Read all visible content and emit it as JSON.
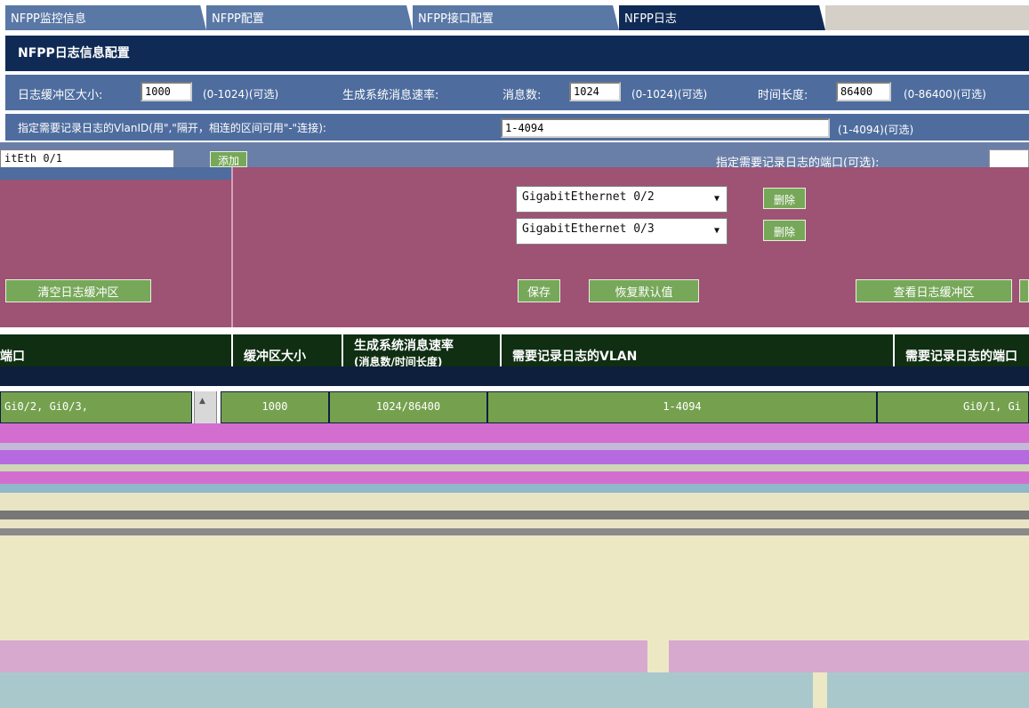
{
  "tabs": [
    {
      "label": "NFPP监控信息"
    },
    {
      "label": "NFPP配置"
    },
    {
      "label": "NFPP接口配置"
    },
    {
      "label": "NFPP日志"
    }
  ],
  "panel_title": "NFPP日志信息配置",
  "buffer": {
    "label": "日志缓冲区大小:",
    "value": "1000",
    "range": "(0-1024)(可选)"
  },
  "rate": {
    "label": "生成系统消息速率:",
    "count_label": "消息数:",
    "count_value": "1024",
    "count_range": "(0-1024)(可选)",
    "time_label": "时间长度:",
    "time_value": "86400",
    "time_range": "(0-86400)(可选)"
  },
  "vlan": {
    "label": "指定需要记录日志的VlanID(用\",\"隔开，相连的区间可用\"-\"连接):",
    "value": "1-4094",
    "range": "(1-4094)(可选)"
  },
  "port_area": {
    "left_select": "itEth    0/1",
    "add_label": "添加",
    "right_heading": "指定需要记录日志的端口(可选):"
  },
  "ports": [
    {
      "name": "GigabitEthernet 0/2",
      "delete": "删除"
    },
    {
      "name": "GigabitEthernet 0/3",
      "delete": "删除"
    }
  ],
  "buttons": {
    "clear": "清空日志缓冲区",
    "save": "保存",
    "restore": "恢复默认值",
    "view": "查看日志缓冲区"
  },
  "table": {
    "headers": {
      "port": "端口",
      "buffer": "缓冲区大小",
      "rate_line1": "生成系统消息速率",
      "rate_line2": "(消息数/时间长度)",
      "vlan": "需要记录日志的VLAN",
      "port2": "需要记录日志的端口"
    },
    "row": {
      "port": "Gi0/2, Gi0/3,",
      "buffer": "1000",
      "rate": "1024/86400",
      "vlan": "1-4094",
      "port2": "Gi0/1, Gi"
    }
  },
  "colors": {
    "dark_navy": "#0f2a55",
    "tab_blue": "#5a78a6",
    "rose": "#9e5274",
    "button_green": "#77a85a",
    "header_dark_green": "#0f2e12",
    "pink_stripe": "#d36ed0"
  }
}
